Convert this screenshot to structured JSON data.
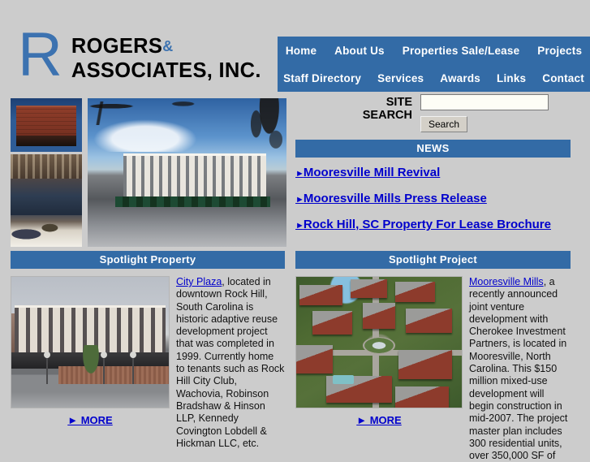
{
  "site": {
    "logo_letter": "R",
    "logo_line1_pre": "ROGERS",
    "logo_amp": "&",
    "logo_line2": "ASSOCIATES, INC."
  },
  "colors": {
    "brand_blue": "#336ba6",
    "logo_blue": "#3c72b0",
    "link_blue": "#0000cc",
    "page_bg": "#cccccc"
  },
  "nav": {
    "row1": [
      {
        "label": "Home"
      },
      {
        "label": "About Us"
      },
      {
        "label": "Properties Sale/Lease"
      },
      {
        "label": "Projects"
      }
    ],
    "row2": [
      {
        "label": "Staff Directory"
      },
      {
        "label": "Services"
      },
      {
        "label": "Awards"
      },
      {
        "label": "Links"
      },
      {
        "label": "Contact"
      }
    ]
  },
  "search": {
    "label_line1": "SITE",
    "label_line2": "SEARCH",
    "value": "",
    "placeholder": "",
    "button_label": "Search"
  },
  "news": {
    "heading": "NEWS",
    "items": [
      {
        "arrow": "►",
        "label": "Mooresville Mill Revival"
      },
      {
        "arrow": "►",
        "label": "Mooresville Mills Press Release"
      },
      {
        "arrow": "►",
        "label": "Rock Hill, SC Property For Lease Brochure"
      }
    ]
  },
  "spotlight_property": {
    "heading": "Spotlight Property",
    "link_label": "City Plaza",
    "body": ", located in downtown Rock Hill, South Carolina is historic adaptive reuse development project that was completed in 1999. Currently home to tenants such as Rock Hill City Club, Wachovia, Robinson Bradshaw & Hinson LLP, Kennedy Covington Lobdell & Hickman LLC, etc.",
    "more_label": "► MORE",
    "image_alt": "City Plaza building exterior"
  },
  "spotlight_project": {
    "heading": "Spotlight Project",
    "link_label": "Mooresville Mills",
    "body": ", a recently announced joint venture development with Cherokee Investment Partners, is located in Mooresville, North Carolina. This $150 million mixed-use development will begin construction in mid-2007. The project master plan includes 300 residential units, over 350,000 SF of",
    "more_label": "► MORE",
    "image_alt": "Mooresville Mills site master plan rendering"
  },
  "collage": {
    "image1_alt": "Historic red brick building at dusk",
    "image2_alt": "Interior banquet hall with guests",
    "image3_alt": "City Plaza street corner view"
  }
}
